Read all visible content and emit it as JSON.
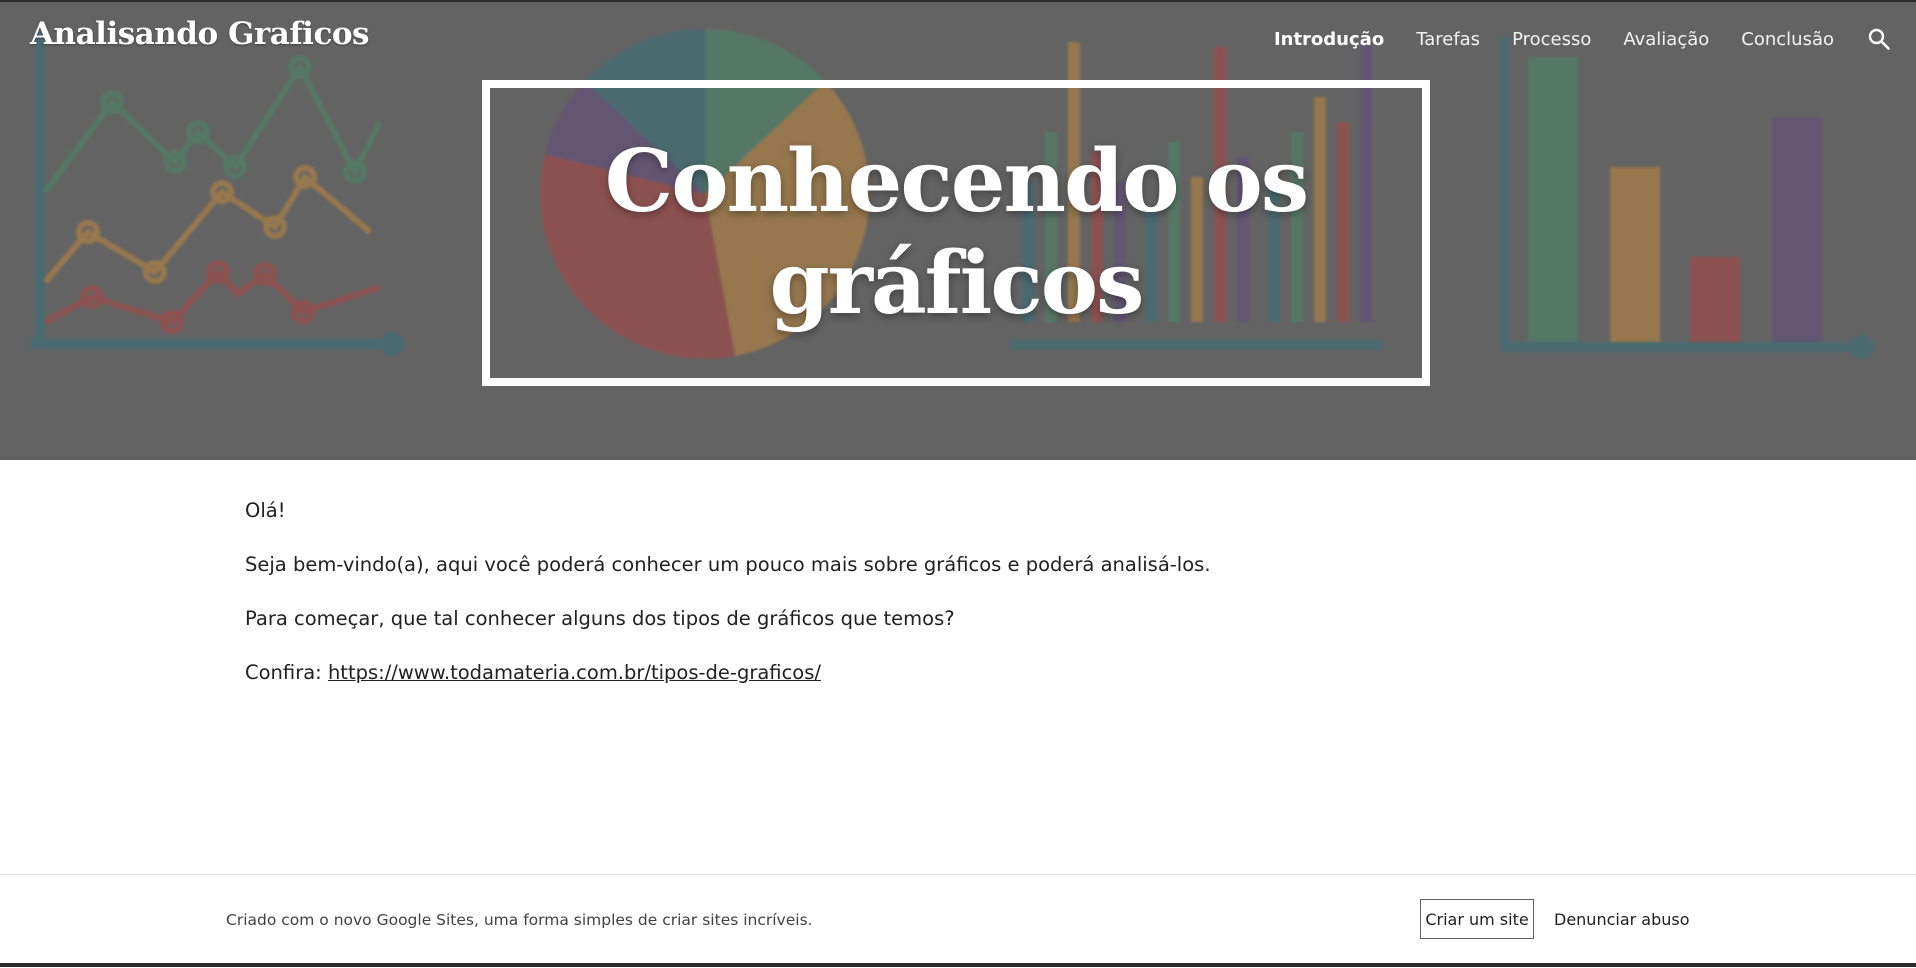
{
  "site": {
    "title": "Analisando Graficos"
  },
  "nav": {
    "items": [
      {
        "label": "Introdução",
        "active": true
      },
      {
        "label": "Tarefas"
      },
      {
        "label": "Processo"
      },
      {
        "label": "Avaliação"
      },
      {
        "label": "Conclusão"
      }
    ],
    "search_icon": "search-icon"
  },
  "hero": {
    "title": "Conhecendo os gráficos",
    "background_colors": {
      "green": "#4a9a72",
      "orange": "#e39a3a",
      "red": "#c9403d",
      "purple": "#6a4c8f",
      "teal": "#2e7b8a"
    }
  },
  "content": {
    "greeting": "Olá!",
    "welcome": "Seja bem-vindo(a), aqui você poderá conhecer um pouco mais sobre gráficos e poderá analisá-los.",
    "question": "Para começar, que tal conhecer alguns dos tipos de gráficos que temos?",
    "confira_label": "Confira:",
    "link": "https://www.todamateria.com.br/tipos-de-graficos/"
  },
  "footer": {
    "text": "Criado com o novo Google Sites, uma forma simples de criar sites incríveis.",
    "create_button": "Criar um site",
    "report_link": "Denunciar abuso"
  }
}
